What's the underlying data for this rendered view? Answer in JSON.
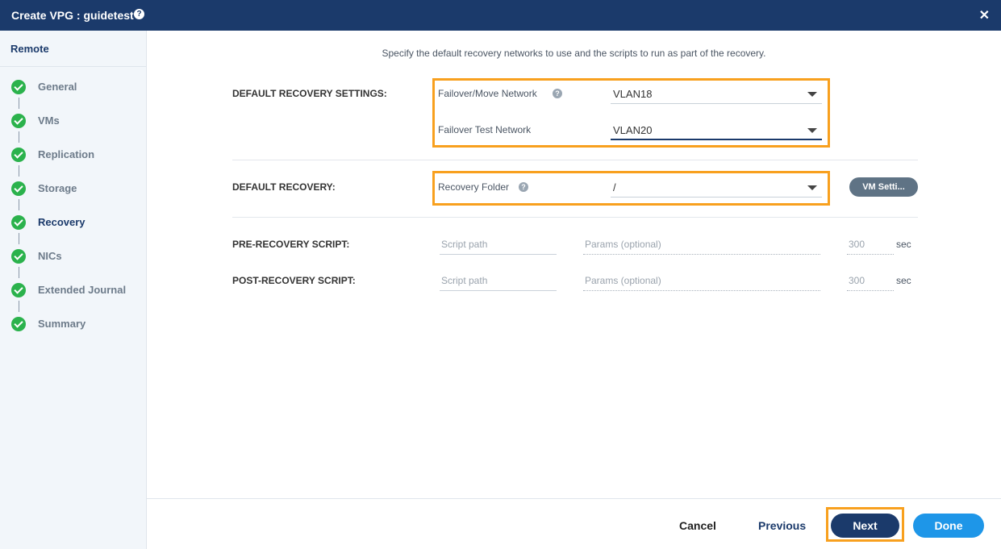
{
  "window": {
    "title": "Create VPG : guidetest",
    "help_icon": "question-circle-icon",
    "close_icon": "close-icon",
    "close_glyph": "✕"
  },
  "sidebar": {
    "header": "Remote",
    "steps": [
      {
        "label": "General",
        "status": "complete"
      },
      {
        "label": "VMs",
        "status": "complete"
      },
      {
        "label": "Replication",
        "status": "complete"
      },
      {
        "label": "Storage",
        "status": "complete"
      },
      {
        "label": "Recovery",
        "status": "complete",
        "active": true
      },
      {
        "label": "NICs",
        "status": "complete"
      },
      {
        "label": "Extended Journal",
        "status": "complete"
      },
      {
        "label": "Summary",
        "status": "complete"
      }
    ]
  },
  "main": {
    "intro": "Specify the default recovery networks to use and the scripts to run as part of the recovery.",
    "recovery_settings": {
      "label": "DEFAULT RECOVERY SETTINGS:",
      "failover_move_network": {
        "label": "Failover/Move Network",
        "value": "VLAN18"
      },
      "failover_test_network": {
        "label": "Failover Test Network",
        "value": "VLAN20"
      }
    },
    "default_recovery": {
      "label": "DEFAULT RECOVERY:",
      "recovery_folder": {
        "label": "Recovery Folder",
        "value": "/"
      },
      "vm_settings_button": "VM Setti..."
    },
    "pre_recovery_script": {
      "label": "PRE-RECOVERY SCRIPT:",
      "path_placeholder": "Script path",
      "params_placeholder": "Params (optional)",
      "timeout_placeholder": "300",
      "unit": "sec"
    },
    "post_recovery_script": {
      "label": "POST-RECOVERY SCRIPT:",
      "path_placeholder": "Script path",
      "params_placeholder": "Params (optional)",
      "timeout_placeholder": "300",
      "unit": "sec"
    }
  },
  "footer": {
    "cancel": "Cancel",
    "previous": "Previous",
    "next": "Next",
    "done": "Done"
  },
  "colors": {
    "header_bg": "#1b3a6b",
    "highlight": "#f8a01e",
    "check_green": "#2bb24c",
    "done_blue": "#1e96e8",
    "next_navy": "#1b3a6b"
  }
}
